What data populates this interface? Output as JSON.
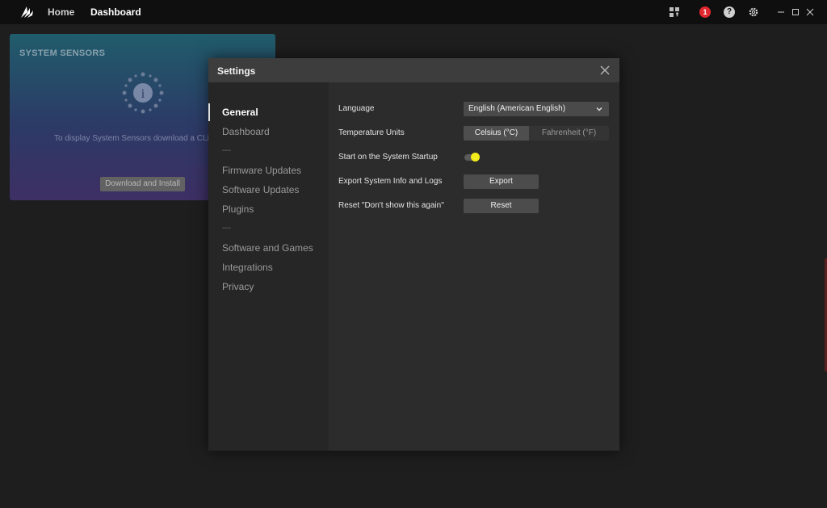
{
  "topbar": {
    "nav": {
      "home": "Home",
      "dashboard": "Dashboard"
    },
    "notification_count": "1",
    "help_glyph": "?",
    "icons": [
      "corsair-logo",
      "grid-icon",
      "notification-icon",
      "help-icon",
      "gear-icon",
      "minimize-icon",
      "maximize-icon",
      "close-icon"
    ]
  },
  "card": {
    "title": "SYSTEM SENSORS",
    "message": "To display System Sensors download a CLink",
    "button": "Download and Install"
  },
  "dialog": {
    "title": "Settings",
    "sidebar": {
      "items": [
        {
          "label": "General",
          "active": true
        },
        {
          "label": "Dashboard"
        },
        {
          "label": "—"
        },
        {
          "label": "Firmware Updates"
        },
        {
          "label": "Software Updates"
        },
        {
          "label": "Plugins"
        },
        {
          "label": "—"
        },
        {
          "label": "Software and Games"
        },
        {
          "label": "Integrations"
        },
        {
          "label": "Privacy"
        }
      ]
    },
    "settings": {
      "language_label": "Language",
      "language_value": "English (American English)",
      "temp_label": "Temperature Units",
      "temp_celsius": "Celsius (°C)",
      "temp_fahrenheit": "Fahrenheit (°F)",
      "temp_selected": "Celsius (°C)",
      "startup_label": "Start on the System Startup",
      "startup_enabled": true,
      "export_label": "Export System Info and Logs",
      "export_button": "Export",
      "reset_label": "Reset \"Don't show this again\"",
      "reset_button": "Reset"
    }
  },
  "colors": {
    "accent_toggle": "#f2ea1a",
    "badge": "#e0282e"
  }
}
